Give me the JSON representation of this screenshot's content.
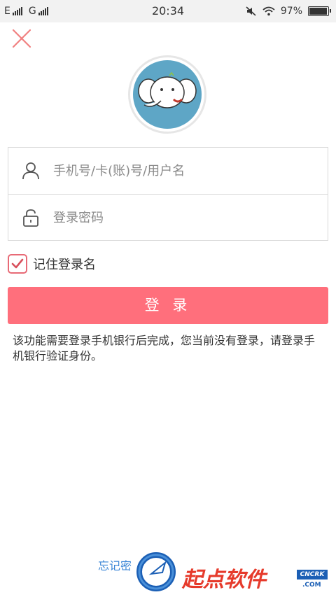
{
  "status_bar": {
    "carrier1": "E",
    "carrier2": "G",
    "time": "20:34",
    "battery": "97%",
    "battery_level": 0.97
  },
  "login": {
    "username_placeholder": "手机号/卡(账)号/用户名",
    "password_placeholder": "登录密码",
    "remember_label": "记住登录名",
    "remember_checked": true,
    "login_button": "登 录",
    "notice": "该功能需要登录手机银行后完成，您当前没有登录，请登录手机银行验证身份。",
    "forgot_link": "忘记密"
  },
  "watermark": {
    "brand": "起点软件",
    "tag": "CNCRK",
    "domain": ".COM"
  },
  "colors": {
    "accent": "#ff6f7c",
    "close": "#f08080",
    "checkbox": "#e86a76",
    "link": "#3b86d6"
  },
  "icons": [
    "close-icon",
    "elephant-avatar",
    "user-icon",
    "lock-icon",
    "check-icon",
    "signal-icon",
    "mute-icon",
    "wifi-icon",
    "battery-icon"
  ]
}
